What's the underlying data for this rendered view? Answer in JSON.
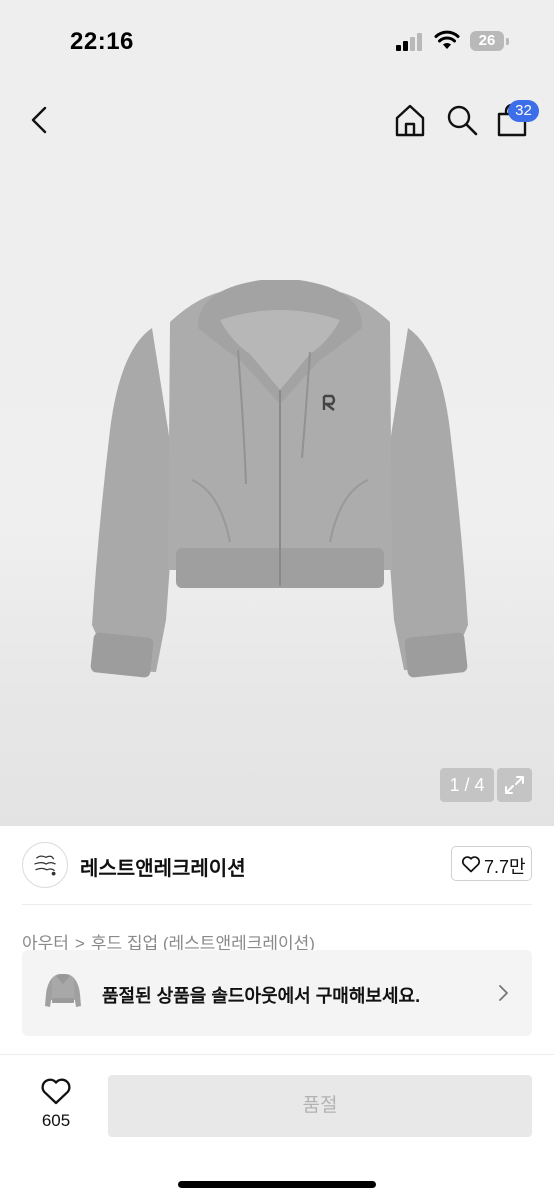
{
  "status_bar": {
    "time": "22:16",
    "battery": "26"
  },
  "nav": {
    "back_icon": "chevron-left-icon",
    "home_icon": "home-icon",
    "search_icon": "search-icon",
    "cart_icon": "shopping-bag-icon",
    "cart_badge": "32",
    "badge_color": "#3b6ee8"
  },
  "gallery": {
    "page_indicator": "1 / 4",
    "expand_icon": "expand-icon"
  },
  "shop": {
    "name": "레스트앤레크레이션",
    "like_count": "7.7만",
    "like_icon": "heart-icon"
  },
  "category": {
    "parent": "아우터",
    "child": "후드 집업 (레스트앤레크레이션)"
  },
  "soldout_banner": {
    "text": "품절된 상품을 솔드아웃에서 구매해보세요."
  },
  "bottom": {
    "wish_count": "605",
    "buy_label": "품절",
    "wish_icon": "heart-icon"
  }
}
